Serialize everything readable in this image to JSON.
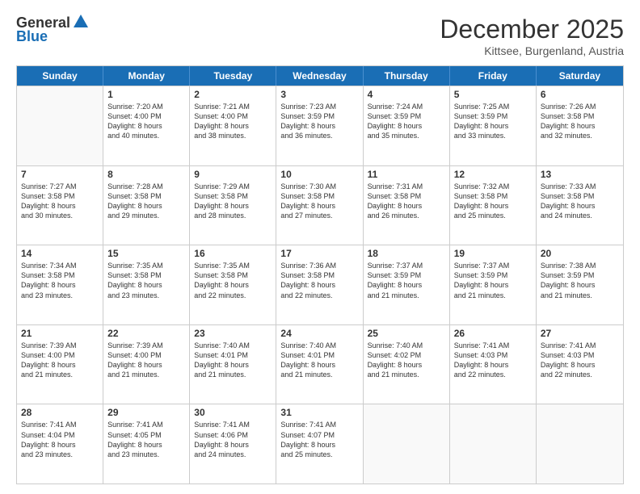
{
  "header": {
    "logo_line1": "General",
    "logo_line2": "Blue",
    "month": "December 2025",
    "location": "Kittsee, Burgenland, Austria"
  },
  "days_of_week": [
    "Sunday",
    "Monday",
    "Tuesday",
    "Wednesday",
    "Thursday",
    "Friday",
    "Saturday"
  ],
  "weeks": [
    [
      {
        "day": "",
        "lines": []
      },
      {
        "day": "1",
        "lines": [
          "Sunrise: 7:20 AM",
          "Sunset: 4:00 PM",
          "Daylight: 8 hours",
          "and 40 minutes."
        ]
      },
      {
        "day": "2",
        "lines": [
          "Sunrise: 7:21 AM",
          "Sunset: 4:00 PM",
          "Daylight: 8 hours",
          "and 38 minutes."
        ]
      },
      {
        "day": "3",
        "lines": [
          "Sunrise: 7:23 AM",
          "Sunset: 3:59 PM",
          "Daylight: 8 hours",
          "and 36 minutes."
        ]
      },
      {
        "day": "4",
        "lines": [
          "Sunrise: 7:24 AM",
          "Sunset: 3:59 PM",
          "Daylight: 8 hours",
          "and 35 minutes."
        ]
      },
      {
        "day": "5",
        "lines": [
          "Sunrise: 7:25 AM",
          "Sunset: 3:59 PM",
          "Daylight: 8 hours",
          "and 33 minutes."
        ]
      },
      {
        "day": "6",
        "lines": [
          "Sunrise: 7:26 AM",
          "Sunset: 3:58 PM",
          "Daylight: 8 hours",
          "and 32 minutes."
        ]
      }
    ],
    [
      {
        "day": "7",
        "lines": [
          "Sunrise: 7:27 AM",
          "Sunset: 3:58 PM",
          "Daylight: 8 hours",
          "and 30 minutes."
        ]
      },
      {
        "day": "8",
        "lines": [
          "Sunrise: 7:28 AM",
          "Sunset: 3:58 PM",
          "Daylight: 8 hours",
          "and 29 minutes."
        ]
      },
      {
        "day": "9",
        "lines": [
          "Sunrise: 7:29 AM",
          "Sunset: 3:58 PM",
          "Daylight: 8 hours",
          "and 28 minutes."
        ]
      },
      {
        "day": "10",
        "lines": [
          "Sunrise: 7:30 AM",
          "Sunset: 3:58 PM",
          "Daylight: 8 hours",
          "and 27 minutes."
        ]
      },
      {
        "day": "11",
        "lines": [
          "Sunrise: 7:31 AM",
          "Sunset: 3:58 PM",
          "Daylight: 8 hours",
          "and 26 minutes."
        ]
      },
      {
        "day": "12",
        "lines": [
          "Sunrise: 7:32 AM",
          "Sunset: 3:58 PM",
          "Daylight: 8 hours",
          "and 25 minutes."
        ]
      },
      {
        "day": "13",
        "lines": [
          "Sunrise: 7:33 AM",
          "Sunset: 3:58 PM",
          "Daylight: 8 hours",
          "and 24 minutes."
        ]
      }
    ],
    [
      {
        "day": "14",
        "lines": [
          "Sunrise: 7:34 AM",
          "Sunset: 3:58 PM",
          "Daylight: 8 hours",
          "and 23 minutes."
        ]
      },
      {
        "day": "15",
        "lines": [
          "Sunrise: 7:35 AM",
          "Sunset: 3:58 PM",
          "Daylight: 8 hours",
          "and 23 minutes."
        ]
      },
      {
        "day": "16",
        "lines": [
          "Sunrise: 7:35 AM",
          "Sunset: 3:58 PM",
          "Daylight: 8 hours",
          "and 22 minutes."
        ]
      },
      {
        "day": "17",
        "lines": [
          "Sunrise: 7:36 AM",
          "Sunset: 3:58 PM",
          "Daylight: 8 hours",
          "and 22 minutes."
        ]
      },
      {
        "day": "18",
        "lines": [
          "Sunrise: 7:37 AM",
          "Sunset: 3:59 PM",
          "Daylight: 8 hours",
          "and 21 minutes."
        ]
      },
      {
        "day": "19",
        "lines": [
          "Sunrise: 7:37 AM",
          "Sunset: 3:59 PM",
          "Daylight: 8 hours",
          "and 21 minutes."
        ]
      },
      {
        "day": "20",
        "lines": [
          "Sunrise: 7:38 AM",
          "Sunset: 3:59 PM",
          "Daylight: 8 hours",
          "and 21 minutes."
        ]
      }
    ],
    [
      {
        "day": "21",
        "lines": [
          "Sunrise: 7:39 AM",
          "Sunset: 4:00 PM",
          "Daylight: 8 hours",
          "and 21 minutes."
        ]
      },
      {
        "day": "22",
        "lines": [
          "Sunrise: 7:39 AM",
          "Sunset: 4:00 PM",
          "Daylight: 8 hours",
          "and 21 minutes."
        ]
      },
      {
        "day": "23",
        "lines": [
          "Sunrise: 7:40 AM",
          "Sunset: 4:01 PM",
          "Daylight: 8 hours",
          "and 21 minutes."
        ]
      },
      {
        "day": "24",
        "lines": [
          "Sunrise: 7:40 AM",
          "Sunset: 4:01 PM",
          "Daylight: 8 hours",
          "and 21 minutes."
        ]
      },
      {
        "day": "25",
        "lines": [
          "Sunrise: 7:40 AM",
          "Sunset: 4:02 PM",
          "Daylight: 8 hours",
          "and 21 minutes."
        ]
      },
      {
        "day": "26",
        "lines": [
          "Sunrise: 7:41 AM",
          "Sunset: 4:03 PM",
          "Daylight: 8 hours",
          "and 22 minutes."
        ]
      },
      {
        "day": "27",
        "lines": [
          "Sunrise: 7:41 AM",
          "Sunset: 4:03 PM",
          "Daylight: 8 hours",
          "and 22 minutes."
        ]
      }
    ],
    [
      {
        "day": "28",
        "lines": [
          "Sunrise: 7:41 AM",
          "Sunset: 4:04 PM",
          "Daylight: 8 hours",
          "and 23 minutes."
        ]
      },
      {
        "day": "29",
        "lines": [
          "Sunrise: 7:41 AM",
          "Sunset: 4:05 PM",
          "Daylight: 8 hours",
          "and 23 minutes."
        ]
      },
      {
        "day": "30",
        "lines": [
          "Sunrise: 7:41 AM",
          "Sunset: 4:06 PM",
          "Daylight: 8 hours",
          "and 24 minutes."
        ]
      },
      {
        "day": "31",
        "lines": [
          "Sunrise: 7:41 AM",
          "Sunset: 4:07 PM",
          "Daylight: 8 hours",
          "and 25 minutes."
        ]
      },
      {
        "day": "",
        "lines": []
      },
      {
        "day": "",
        "lines": []
      },
      {
        "day": "",
        "lines": []
      }
    ]
  ]
}
